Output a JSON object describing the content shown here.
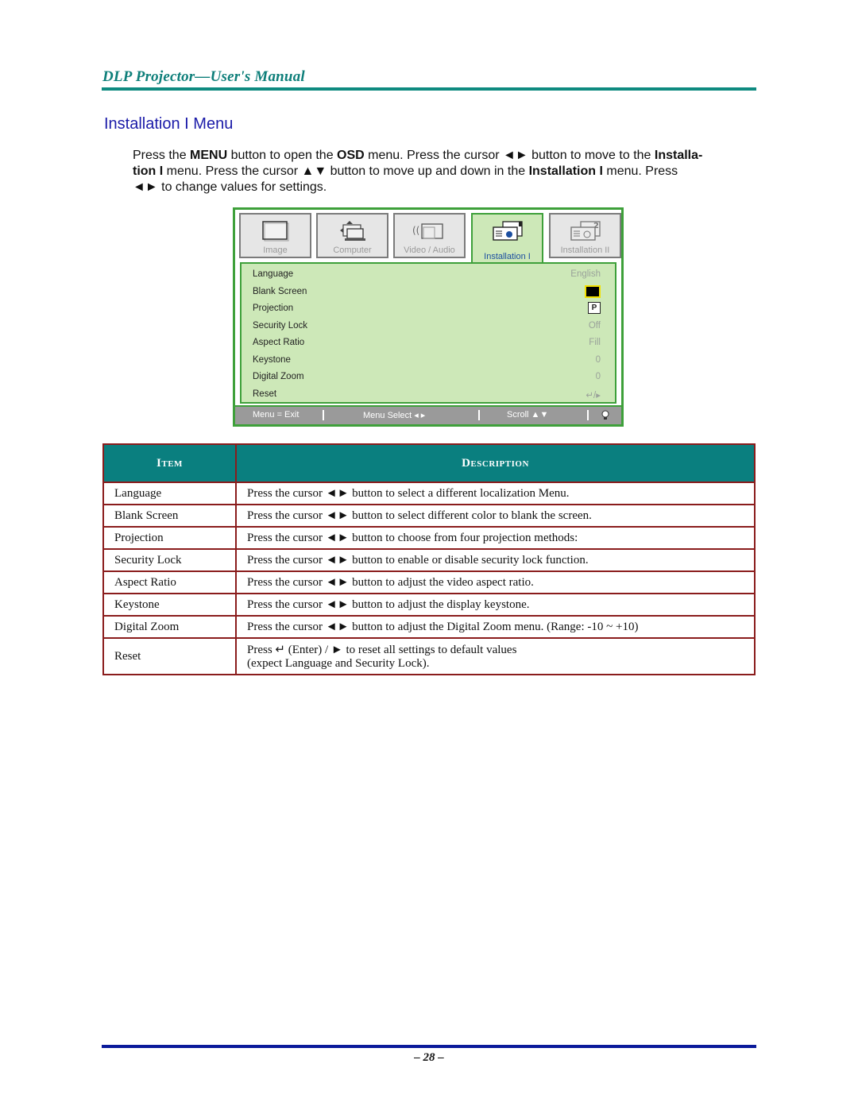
{
  "header": {
    "title": "DLP Projector—User's Manual"
  },
  "section": {
    "title": "Installation I Menu"
  },
  "intro": {
    "p1": "Press the ",
    "menu": "MENU",
    "p2": " button to open the ",
    "osd": "OSD",
    "p3": " menu. Press the cursor ◄► button to move to the ",
    "inst1": "Installa-tion I",
    "p4": " menu. Press the cursor ▲▼ button to move up and down in the ",
    "inst2": "Installation I",
    "p5": " menu. Press ◄► to change values for settings."
  },
  "osd": {
    "tabs": [
      {
        "label": "Image",
        "icon": "monitor-icon",
        "active": false
      },
      {
        "label": "Computer",
        "icon": "computer-icon",
        "active": false
      },
      {
        "label": "Video / Audio",
        "icon": "video-audio-icon",
        "active": false
      },
      {
        "label": "Installation I",
        "icon": "projector-icon",
        "active": true
      },
      {
        "label": "Installation II",
        "icon": "projector-2-icon",
        "active": false
      }
    ],
    "rows": [
      {
        "label": "Language",
        "value": "English"
      },
      {
        "label": "Blank Screen",
        "value": ""
      },
      {
        "label": "Projection",
        "value": "P"
      },
      {
        "label": "Security Lock",
        "value": "Off"
      },
      {
        "label": "Aspect Ratio",
        "value": "Fill"
      },
      {
        "label": "Keystone",
        "value": "0"
      },
      {
        "label": "Digital Zoom",
        "value": "0"
      },
      {
        "label": "Reset",
        "value": "↵/▸"
      }
    ],
    "footer": {
      "exit": "Menu = Exit",
      "select": "Menu Select ◂ ▸",
      "scroll": "Scroll ▲▼",
      "lamp": "lamp-icon"
    }
  },
  "table": {
    "headers": [
      "Item",
      "Description"
    ],
    "rows": [
      {
        "item": "Language",
        "desc": "Press the cursor ◄► button to select a different localization Menu."
      },
      {
        "item": "Blank Screen",
        "desc": "Press the cursor ◄► button to select different color to blank the screen."
      },
      {
        "item": "Projection",
        "desc": "Press the cursor ◄► button to choose from four projection methods:"
      },
      {
        "item": "Security Lock",
        "desc": "Press the cursor ◄► button to enable or disable security lock function."
      },
      {
        "item": "Aspect Ratio",
        "desc": "Press the cursor ◄► button to adjust the video aspect ratio."
      },
      {
        "item": "Keystone",
        "desc": "Press the cursor ◄► button to adjust the display keystone."
      },
      {
        "item": "Digital Zoom",
        "desc": "Press the cursor ◄► button to adjust the Digital Zoom menu. (Range: -10 ~ +10)"
      },
      {
        "item": "Reset",
        "desc": "Press ↵ (Enter) / ► to reset all settings to default values",
        "desc2": "(expect Language and Security Lock)."
      }
    ]
  },
  "footer": {
    "page": "– 28 –"
  }
}
